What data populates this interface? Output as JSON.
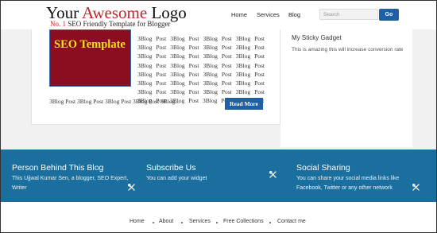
{
  "header": {
    "logo_main": "Your ",
    "logo_accent": "Awesome",
    "logo_end": " Logo",
    "tagline_accent": "No. 1",
    "tagline_rest": " SEO Friendly Template for Blogger",
    "nav": [
      "Home",
      "Services",
      "Blog"
    ],
    "search_placeholder": "Search",
    "go_label": "Go"
  },
  "post": {
    "thumbnail_text": "SEO Template",
    "excerpt": "3Blog Post 3Blog Post 3Blog Post 3Blog Post 3Blog Post 3Blog Post 3Blog Post 3Blog Post 3Blog Post 3Blog Post 3Blog Post 3Blog Post 3Blog Post 3Blog Post 3Blog Post 3Blog Post 3Blog Post 3Blog Post 3Blog Post 3Blog Post 3Blog Post 3Blog Post 3Blog Post 3Blog Post 3Blog Post 3Blog Post 3Blog Post 3Blog Post 3Blog Post 3Blog Post 3Blog Post 3Blog Post",
    "excerpt_tail": "3Blog Post 3Blog Post 3Blog Post 3Blog Post 3Blog...",
    "read_more_label": "Read More"
  },
  "sidebar": {
    "gadget_title": "My Sticky Gadget",
    "gadget_text": "This is amazing this will increase conversion rate"
  },
  "band": {
    "col1_title": "Person Behind This Blog",
    "col1_text": "This Ujjwal Kumar Sen, a blogger, SEO Expert, Writer",
    "col2_title": "Subscribe Us",
    "col2_text": "You can add your widget",
    "col3_title": "Social Sharing",
    "col3_text": "You can share your social media links like Facebook, Twitter or any other network"
  },
  "footer": {
    "links": [
      "Home",
      "About",
      "Services",
      "Free Collections",
      "Contact me"
    ]
  },
  "colors": {
    "brand_blue": "#1f5fa6",
    "band_blue": "#1b6f9e",
    "logo_red": "#c0262c",
    "thumbnail_red": "#8a0e1e",
    "thumbnail_text": "#f0e21e"
  },
  "icons": [
    "tools-icon"
  ]
}
